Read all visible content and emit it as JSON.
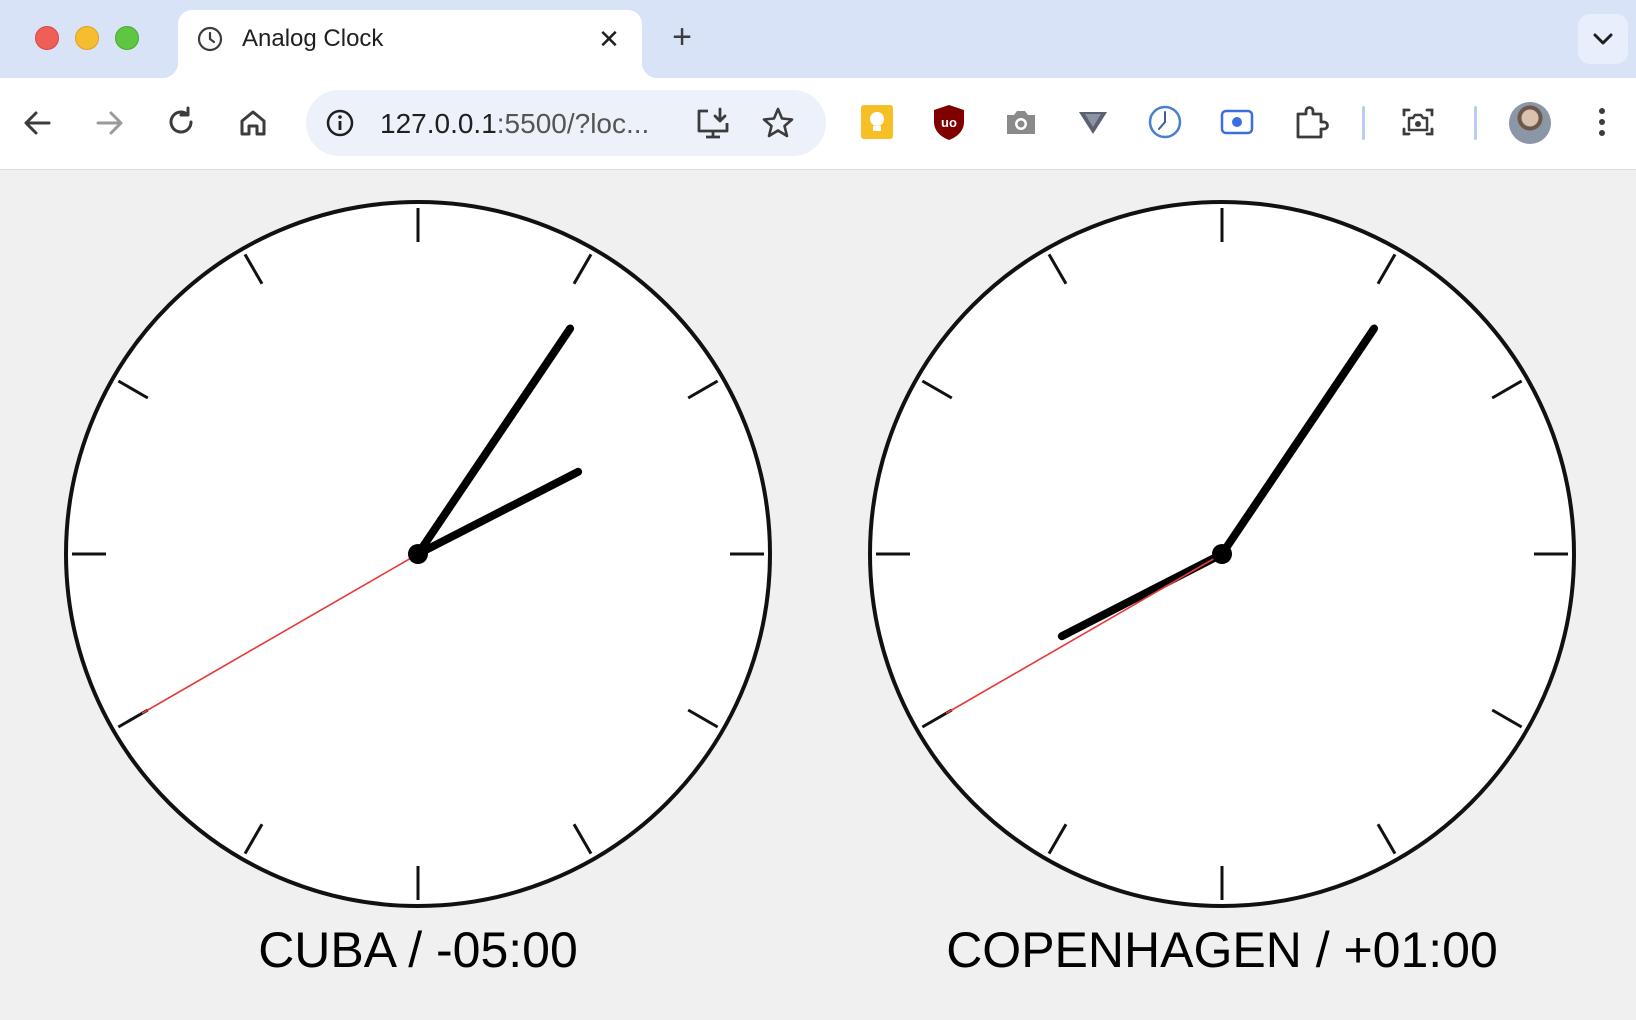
{
  "browser": {
    "tab": {
      "title": "Analog Clock",
      "icon": "clock-icon",
      "close_glyph": "✕"
    },
    "new_tab_glyph": "+",
    "omnibox": {
      "url_main": "127.0.0.1",
      "url_rest": ":5500/?loc..."
    },
    "extensions": [
      "keep-bulb-extension",
      "ublock-origin-extension",
      "camera-extension",
      "triangle-extension",
      "clock-extension",
      "screen-record-extension",
      "puzzle-extensions-icon"
    ]
  },
  "clocks": [
    {
      "label": "CUBA / -05:00",
      "time": {
        "hour": 2,
        "minute": 5,
        "second": 40
      },
      "second_hand_color": "#e83a3a"
    },
    {
      "label": "COPENHAGEN / +01:00",
      "time": {
        "hour": 8,
        "minute": 5,
        "second": 40
      },
      "second_hand_color": "#e83a3a"
    }
  ]
}
